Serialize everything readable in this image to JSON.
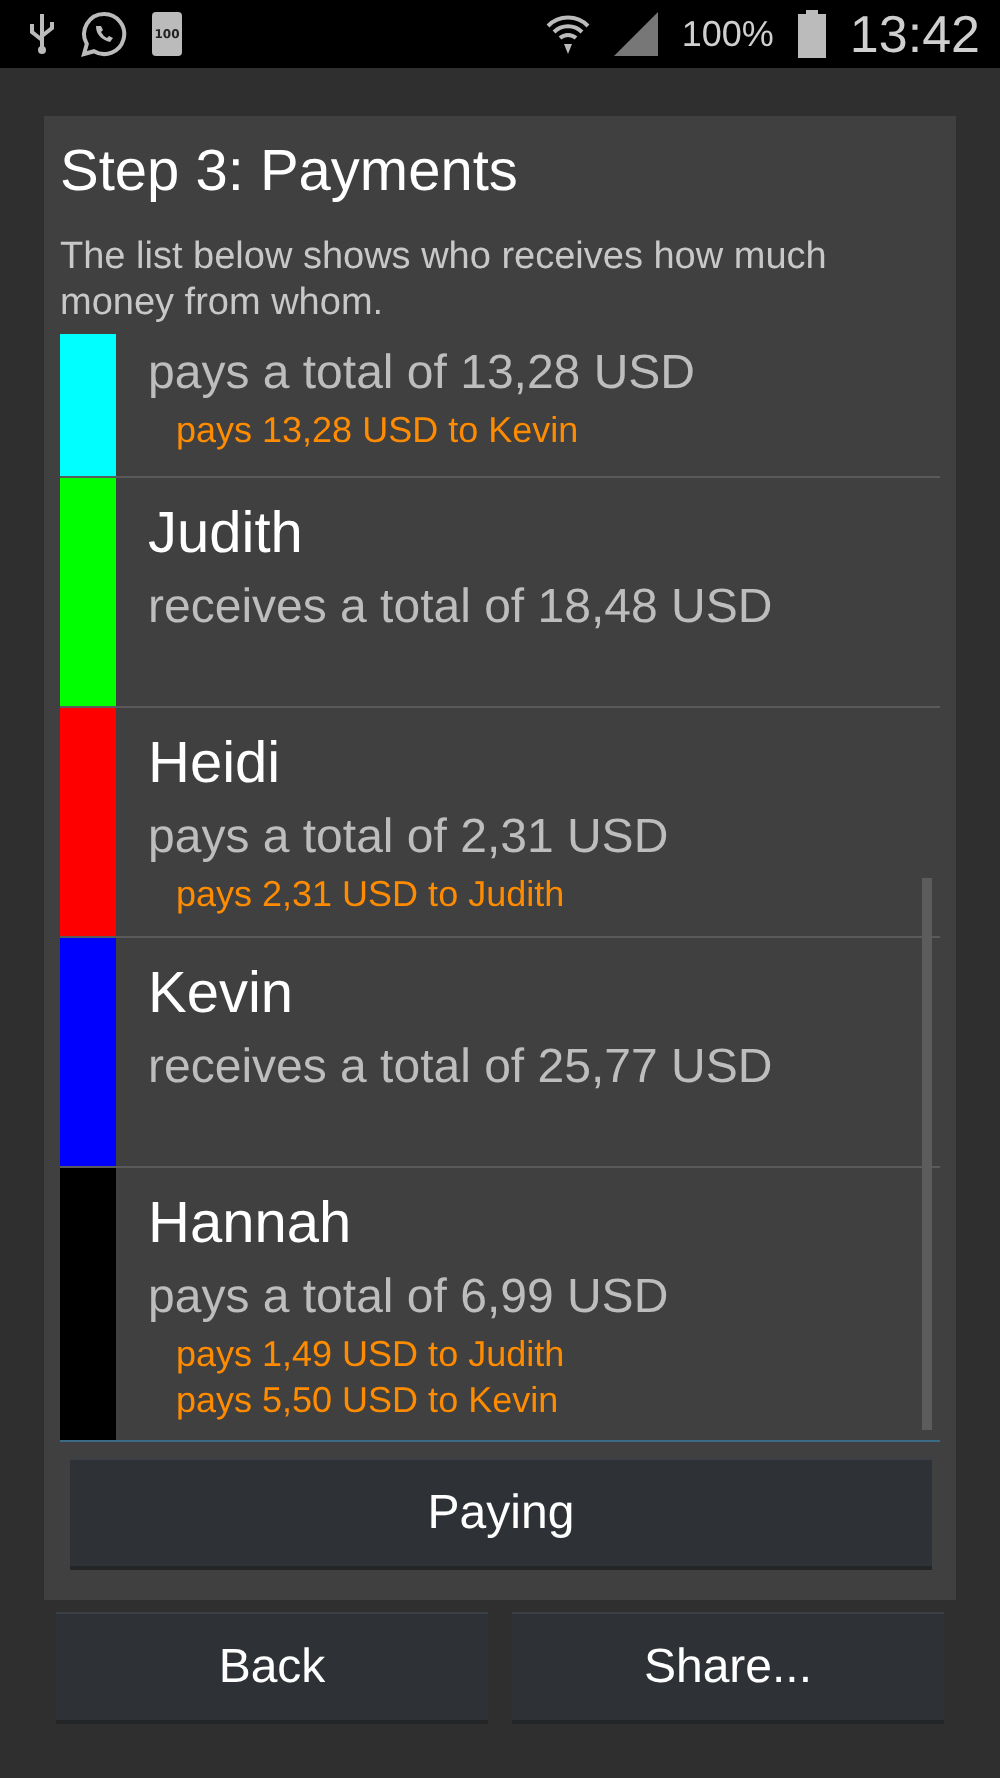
{
  "status_bar": {
    "battery_badge": "100",
    "battery_percent": "100%",
    "time": "13:42"
  },
  "title": "Step 3: Payments",
  "description": "The list below shows who receives how much money from whom.",
  "people": [
    {
      "color": "#00ffff",
      "summary": "pays a total of 13,28 USD",
      "payments": [
        "pays 13,28 USD to Kevin"
      ]
    },
    {
      "color": "#00ff00",
      "name": "Judith",
      "summary": "receives a total of 18,48 USD"
    },
    {
      "color": "#ff0000",
      "name": "Heidi",
      "summary": "pays a total of 2,31 USD",
      "payments": [
        "pays 2,31 USD to Judith"
      ]
    },
    {
      "color": "#0000ff",
      "name": "Kevin",
      "summary": "receives a total of 25,77 USD"
    },
    {
      "color": "#000000",
      "name": "Hannah",
      "summary": "pays a total of 6,99 USD",
      "payments": [
        "pays 1,49 USD to Judith",
        "pays 5,50 USD to Kevin"
      ]
    }
  ],
  "buttons": {
    "paying": "Paying",
    "back": "Back",
    "share": "Share..."
  }
}
